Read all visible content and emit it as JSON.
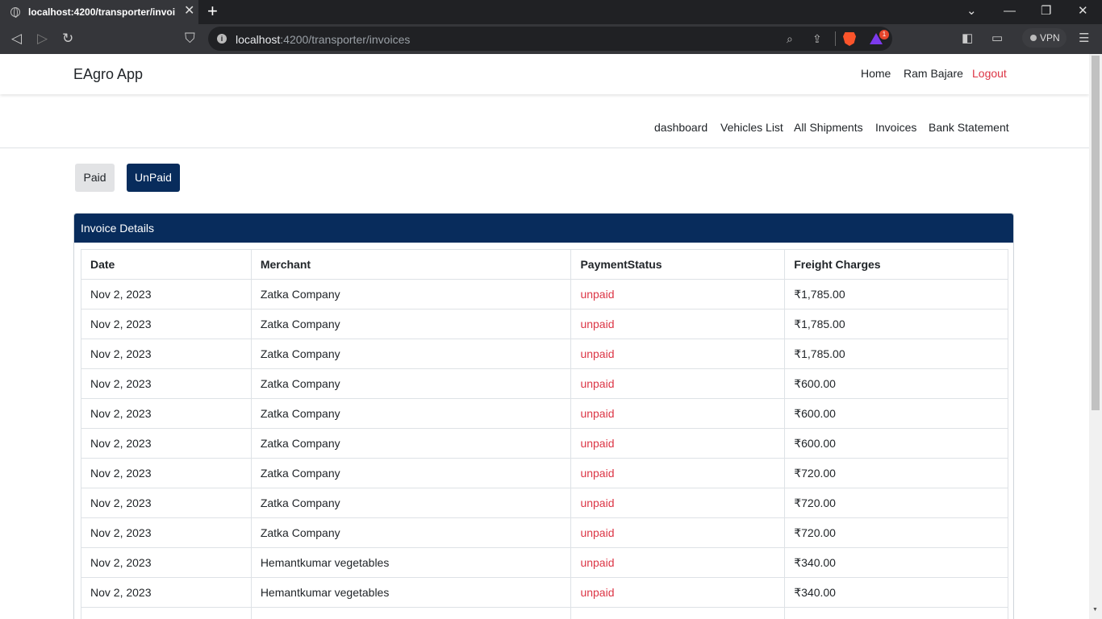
{
  "browser": {
    "tab_title": "localhost:4200/transporter/invoic",
    "url_host": "localhost",
    "url_path": ":4200/transporter/invoices",
    "brave_badge": "1",
    "vpn_label": "VPN"
  },
  "app": {
    "brand": "EAgro App",
    "top_nav": {
      "home": "Home",
      "user": "Ram Bajare",
      "logout": "Logout"
    },
    "sub_nav": {
      "dashboard": "dashboard",
      "vehicles": "Vehicles List",
      "shipments": "All Shipments",
      "invoices": "Invoices",
      "bank": "Bank Statement"
    },
    "filters": {
      "paid": "Paid",
      "unpaid": "UnPaid"
    },
    "card_title": "Invoice Details",
    "table": {
      "headers": {
        "date": "Date",
        "merchant": "Merchant",
        "status": "PaymentStatus",
        "charges": "Freight Charges"
      },
      "rows": [
        {
          "date": "Nov 2, 2023",
          "merchant": "Zatka Company",
          "status": "unpaid",
          "charges": "₹1,785.00"
        },
        {
          "date": "Nov 2, 2023",
          "merchant": "Zatka Company",
          "status": "unpaid",
          "charges": "₹1,785.00"
        },
        {
          "date": "Nov 2, 2023",
          "merchant": "Zatka Company",
          "status": "unpaid",
          "charges": "₹1,785.00"
        },
        {
          "date": "Nov 2, 2023",
          "merchant": "Zatka Company",
          "status": "unpaid",
          "charges": "₹600.00"
        },
        {
          "date": "Nov 2, 2023",
          "merchant": "Zatka Company",
          "status": "unpaid",
          "charges": "₹600.00"
        },
        {
          "date": "Nov 2, 2023",
          "merchant": "Zatka Company",
          "status": "unpaid",
          "charges": "₹600.00"
        },
        {
          "date": "Nov 2, 2023",
          "merchant": "Zatka Company",
          "status": "unpaid",
          "charges": "₹720.00"
        },
        {
          "date": "Nov 2, 2023",
          "merchant": "Zatka Company",
          "status": "unpaid",
          "charges": "₹720.00"
        },
        {
          "date": "Nov 2, 2023",
          "merchant": "Zatka Company",
          "status": "unpaid",
          "charges": "₹720.00"
        },
        {
          "date": "Nov 2, 2023",
          "merchant": "Hemantkumar vegetables",
          "status": "unpaid",
          "charges": "₹340.00"
        },
        {
          "date": "Nov 2, 2023",
          "merchant": "Hemantkumar vegetables",
          "status": "unpaid",
          "charges": "₹340.00"
        },
        {
          "date": "",
          "merchant": "",
          "status": "",
          "charges": ""
        }
      ]
    }
  },
  "colors": {
    "primary": "#082c5c",
    "danger": "#dc3545",
    "secondary_btn": "#e2e3e5"
  }
}
